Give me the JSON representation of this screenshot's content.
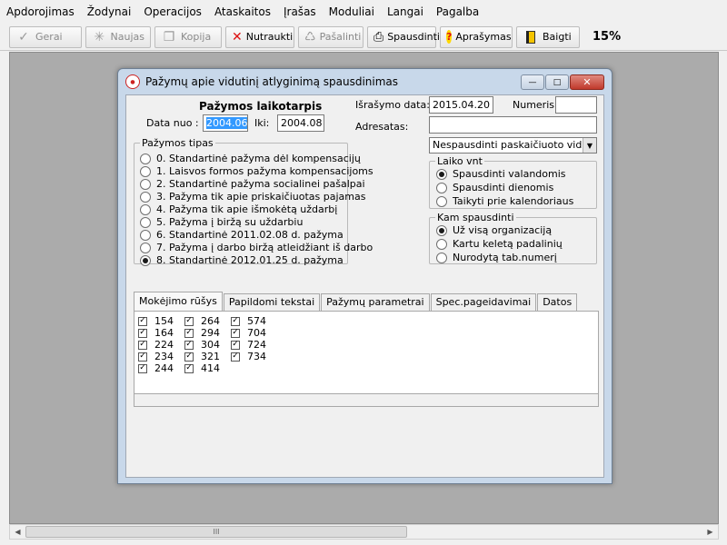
{
  "menu": [
    "Apdorojimas",
    "Žodynai",
    "Operacijos",
    "Ataskaitos",
    "Įrašas",
    "Moduliai",
    "Langai",
    "Pagalba"
  ],
  "toolbar": {
    "buttons": [
      {
        "label": "Gerai",
        "icon": "check-icon"
      },
      {
        "label": "Naujas",
        "icon": "new-icon"
      },
      {
        "label": "Kopija",
        "icon": "copy-icon"
      },
      {
        "label": "Nutraukti",
        "icon": "cancel-x-icon"
      },
      {
        "label": "Pašalinti",
        "icon": "delete-icon"
      },
      {
        "label": "Spausdinti",
        "icon": "printer-icon"
      },
      {
        "label": "Aprašymas",
        "icon": "help-icon"
      },
      {
        "label": "Baigti",
        "icon": "exit-door-icon"
      }
    ],
    "percent": "15%"
  },
  "dialog": {
    "title": "Pažymų apie vidutinį atlyginimą spausdinimas",
    "period": {
      "heading": "Pažymos laikotarpis",
      "from_label": "Data nuo :",
      "from_value": "2004.06",
      "to_label": "Iki:",
      "to_value": "2004.08"
    },
    "issue_date_label": "Išrašymo data:",
    "issue_date_value": "2015.04.20",
    "number_label": "Numeris",
    "number_value": "",
    "addressee_label": "Adresatas:",
    "addressee_value": "",
    "print_mode_value": "Nespausdinti paskaičiuoto vidurkio",
    "types": {
      "legend": "Pažymos tipas",
      "options": [
        "0. Standartinė pažyma dėl kompensacijų",
        "1. Laisvos formos pažyma kompensacijoms",
        "2. Standartinė pažyma socialinei pašalpai",
        "3. Pažyma tik apie priskaičiuotas pajamas",
        "4. Pažyma tik apie išmokėtą uždarbį",
        "5. Pažyma į biržą su uždarbiu",
        "6. Standartinė 2011.02.08 d. pažyma",
        "7. Pažyma į darbo biržą atleidžiant iš darbo",
        "8. Standartinė 2012.01.25 d. pažyma"
      ],
      "selected": 8
    },
    "time_unit": {
      "legend": "Laiko vnt",
      "options": [
        "Spausdinti valandomis",
        "Spausdinti dienomis",
        "Taikyti prie kalendoriaus"
      ],
      "selected": 0
    },
    "target": {
      "legend": "Kam spausdinti",
      "options": [
        "Už visą organizaciją",
        "Kartu keletą padalinių",
        "Nurodytą tab.numerį"
      ],
      "selected": 0
    },
    "tabs": [
      "Mokėjimo rūšys",
      "Papildomi tekstai",
      "Pažymų parametrai",
      "Spec.pageidavimai",
      "Datos"
    ],
    "active_tab": 0,
    "payment_codes": [
      [
        "154",
        "164",
        "224",
        "234",
        "244"
      ],
      [
        "264",
        "294",
        "304",
        "321",
        "414"
      ],
      [
        "574",
        "704",
        "724",
        "734"
      ]
    ],
    "check_mark": "✓"
  },
  "scrollbar": {
    "thumb_grip": "III",
    "left_arrow": "◀",
    "right_arrow": "▶"
  },
  "title_buttons": {
    "minimize": "—",
    "maximize": "□",
    "close": "✕"
  },
  "combo_arrow": "▼"
}
